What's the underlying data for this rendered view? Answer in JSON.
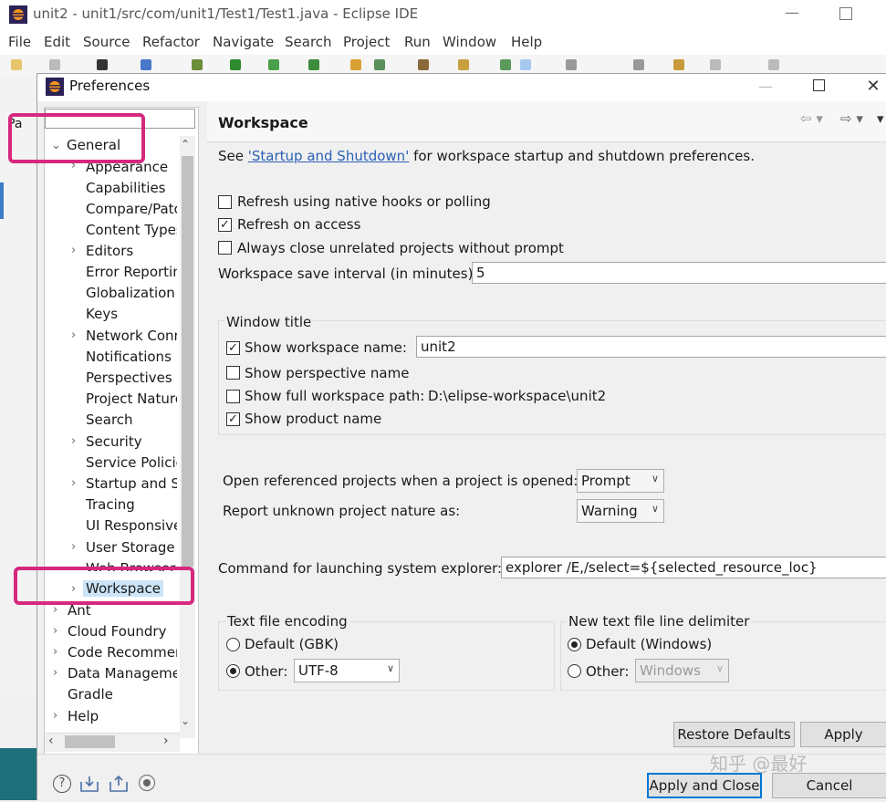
{
  "eclipse": {
    "title": "unit2 - unit1/src/com/unit1/Test1/Test1.java - Eclipse IDE",
    "menu": [
      "File",
      "Edit",
      "Source",
      "Refactor",
      "Navigate",
      "Search",
      "Project",
      "Run",
      "Window",
      "Help"
    ],
    "left_tab_label": "Pa"
  },
  "dialog": {
    "title": "Preferences",
    "filter_placeholder": "",
    "tree": {
      "general": "General",
      "children": [
        "Appearance",
        "Capabilities",
        "Compare/Patch",
        "Content Types",
        "Editors",
        "Error Reporting",
        "Globalization",
        "Keys",
        "Network Connections",
        "Notifications",
        "Perspectives",
        "Project Natures",
        "Search",
        "Security",
        "Service Policies",
        "Startup and Shutdown",
        "Tracing",
        "UI Responsiveness",
        "User Storage",
        "Web Browser",
        "Workspace"
      ],
      "roots": [
        "Ant",
        "Cloud Foundry",
        "Code Recommenders",
        "Data Management",
        "Gradle",
        "Help"
      ]
    },
    "page": {
      "title": "Workspace",
      "intro_prefix": "See ",
      "intro_link": "'Startup and Shutdown'",
      "intro_suffix": " for workspace startup and shutdown preferences.",
      "refresh_native": "Refresh using native hooks or polling",
      "refresh_access": "Refresh on access",
      "always_close": "Always close unrelated projects without prompt",
      "save_interval_label": "Workspace save interval (in minutes):",
      "save_interval_value": "5",
      "window_title_group": "Window title",
      "show_ws_name": "Show workspace name:",
      "ws_name_value": "unit2",
      "show_perspective": "Show perspective name",
      "show_full_path": "Show full workspace path:",
      "full_path_value": "D:\\elipse-workspace\\unit2",
      "show_product": "Show product name",
      "open_ref_label": "Open referenced projects when a project is opened:",
      "open_ref_value": "Prompt",
      "report_unknown_label": "Report unknown project nature as:",
      "report_unknown_value": "Warning",
      "cmd_label": "Command for launching system explorer:",
      "cmd_value": "explorer /E,/select=${selected_resource_loc}",
      "encoding_group": "Text file encoding",
      "enc_default": "Default (GBK)",
      "enc_other": "Other:",
      "enc_other_value": "UTF-8",
      "delim_group": "New text file line delimiter",
      "delim_default": "Default (Windows)",
      "delim_other": "Other:",
      "delim_other_value": "Windows"
    },
    "buttons": {
      "restore": "Restore Defaults",
      "apply": "Apply",
      "apply_close": "Apply and Close",
      "cancel": "Cancel"
    },
    "watermark": "知乎 @最好"
  },
  "colors": {
    "highlight": "#d6287e",
    "link": "#2b60b5",
    "accent": "#0078d7"
  }
}
